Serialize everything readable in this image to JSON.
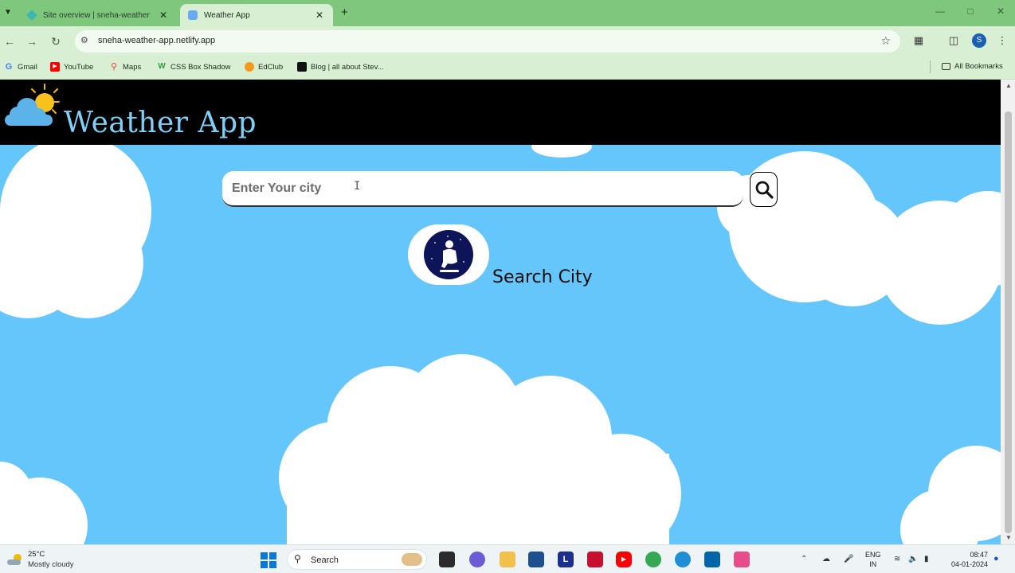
{
  "browser": {
    "tabs": [
      {
        "label": "Site overview | sneha-weather",
        "active": false
      },
      {
        "label": "Weather App",
        "active": true
      }
    ],
    "url": "sneha-weather-app.netlify.app",
    "bookmarks": [
      {
        "label": "Gmail",
        "icon": "gmail-icon"
      },
      {
        "label": "YouTube",
        "icon": "youtube-icon"
      },
      {
        "label": "Maps",
        "icon": "maps-icon"
      },
      {
        "label": "CSS Box Shadow",
        "icon": "w-icon"
      },
      {
        "label": "EdClub",
        "icon": "edclub-icon"
      },
      {
        "label": "Blog | all about Stev...",
        "icon": "blog-icon"
      }
    ],
    "all_bookmarks": "All Bookmarks",
    "profile_initial": "S"
  },
  "app": {
    "title": "Weather App",
    "search": {
      "placeholder": "Enter Your city"
    },
    "status": "Search City"
  },
  "taskbar": {
    "temperature": "25°C",
    "condition": "Mostly cloudy",
    "search_label": "Search",
    "language": "ENG",
    "region": "IN",
    "time": "08:47",
    "date": "04-01-2024"
  },
  "colors": {
    "sky": "#64c6fb",
    "header": "#000000",
    "title": "#7fd0f7",
    "chrome": "#7fc77d"
  }
}
